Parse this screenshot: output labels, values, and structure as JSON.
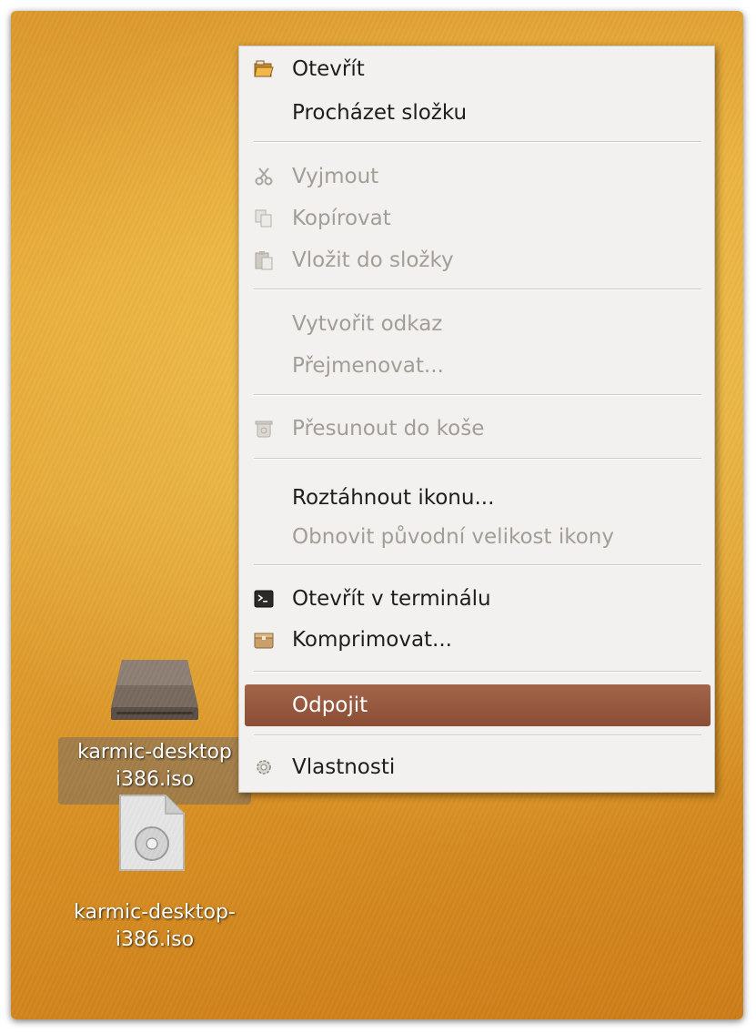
{
  "menu": {
    "items": [
      {
        "label": "Otevřít",
        "icon": "folder-open-icon",
        "disabled": false
      },
      {
        "label": "Procházet složku",
        "icon": "",
        "disabled": false
      },
      {
        "label": "Vyjmout",
        "icon": "scissors-icon",
        "disabled": true
      },
      {
        "label": "Kopírovat",
        "icon": "copy-icon",
        "disabled": true
      },
      {
        "label": "Vložit do složky",
        "icon": "paste-icon",
        "disabled": true
      },
      {
        "label": "Vytvořit odkaz",
        "icon": "",
        "disabled": true
      },
      {
        "label": "Přejmenovat...",
        "icon": "",
        "disabled": true
      },
      {
        "label": "Přesunout do koše",
        "icon": "trash-icon",
        "disabled": true
      },
      {
        "label": "Roztáhnout ikonu...",
        "icon": "",
        "disabled": false
      },
      {
        "label": "Obnovit původní velikost ikony",
        "icon": "",
        "disabled": true
      },
      {
        "label": "Otevřít v terminálu",
        "icon": "terminal-icon",
        "disabled": false
      },
      {
        "label": "Komprimovat...",
        "icon": "archive-icon",
        "disabled": false
      },
      {
        "label": "Odpojit",
        "icon": "",
        "disabled": false,
        "selected": true
      },
      {
        "label": "Vlastnosti",
        "icon": "gear-icon",
        "disabled": false
      }
    ]
  },
  "desktop": {
    "drive": {
      "label_line1": "karmic-desktop",
      "label_line2": "i386.iso",
      "icon": "drive-icon"
    },
    "iso_file": {
      "label_line1": "karmic-desktop-",
      "label_line2": "i386.iso",
      "icon": "disc-image-icon"
    }
  },
  "colors": {
    "selection": "#94573d",
    "disabled_text": "#a29e97",
    "menu_bg": "#f2f1ef"
  }
}
